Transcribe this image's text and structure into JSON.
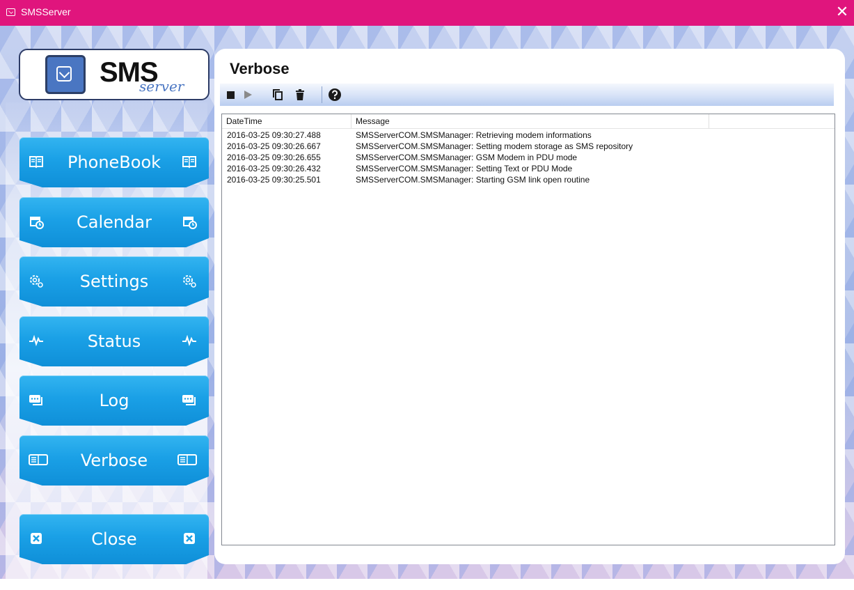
{
  "window": {
    "title": "SMSServer",
    "close_glyph": "✕"
  },
  "logo": {
    "primary": "SMS",
    "secondary": "server",
    "icon": "envelope-icon"
  },
  "nav": [
    {
      "label": "PhoneBook",
      "icon": "book-icon"
    },
    {
      "label": "Calendar",
      "icon": "calendar-clock-icon"
    },
    {
      "label": "Settings",
      "icon": "gears-icon"
    },
    {
      "label": "Status",
      "icon": "pulse-icon"
    },
    {
      "label": "Log",
      "icon": "chat-bubbles-icon"
    },
    {
      "label": "Verbose",
      "icon": "verbose-book-icon"
    }
  ],
  "close_button": {
    "label": "Close",
    "icon": "close-box-icon"
  },
  "panel": {
    "heading": "Verbose",
    "toolbar": [
      "stop-icon",
      "play-icon",
      "copy-icon",
      "trash-icon",
      "help-icon"
    ],
    "columns": [
      "DateTime",
      "Message"
    ],
    "rows": [
      {
        "datetime": "2016-03-25 09:30:27.488",
        "message": "SMSServerCOM.SMSManager: Retrieving modem informations"
      },
      {
        "datetime": "2016-03-25 09:30:26.667",
        "message": "SMSServerCOM.SMSManager: Setting modem storage as SMS repository"
      },
      {
        "datetime": "2016-03-25 09:30:26.655",
        "message": "SMSServerCOM.SMSManager: GSM Modem in PDU mode"
      },
      {
        "datetime": "2016-03-25 09:30:26.432",
        "message": "SMSServerCOM.SMSManager: Setting Text or PDU Mode"
      },
      {
        "datetime": "2016-03-25 09:30:25.501",
        "message": "SMSServerCOM.SMSManager: Starting GSM link open routine"
      }
    ]
  },
  "colors": {
    "titlebar": "#e0157d",
    "button": "#1aa0e6",
    "toolbar": "#c9d8f3"
  }
}
